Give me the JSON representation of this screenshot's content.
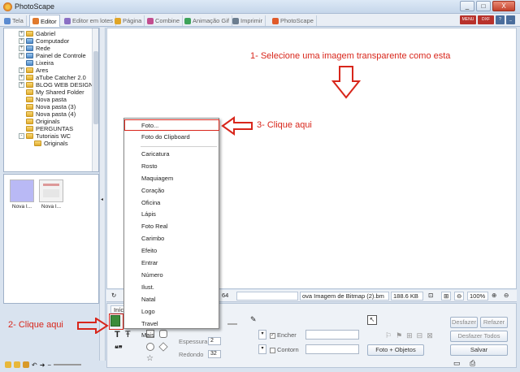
{
  "window": {
    "title": "PhotoScape",
    "controls": [
      "_",
      "□",
      "X"
    ]
  },
  "tabs": [
    {
      "label": "Tela",
      "color": "#5b8bd0",
      "active": false
    },
    {
      "label": "Editor",
      "color": "#e07a2e",
      "active": true
    },
    {
      "label": "Editor em lotes",
      "color": "#8a6fc4",
      "active": false
    },
    {
      "label": "Página",
      "color": "#e0a526",
      "active": false
    },
    {
      "label": "Combine",
      "color": "#c24d8f",
      "active": false
    },
    {
      "label": "Animação Gif",
      "color": "#3da35a",
      "active": false
    },
    {
      "label": "Imprimir",
      "color": "#6b7d8f",
      "active": false
    },
    {
      "label": "PhotoScape",
      "color": "#e05a2a",
      "active": false
    }
  ],
  "top_icons": [
    "MENU",
    "DXF",
    "?",
    "_"
  ],
  "tree": [
    {
      "label": "Gabriel",
      "expander": "+",
      "indent": 1,
      "icon": "folder"
    },
    {
      "label": "Computador",
      "expander": "+",
      "indent": 1,
      "icon": "folder-blue"
    },
    {
      "label": "Rede",
      "expander": "+",
      "indent": 1,
      "icon": "folder-blue"
    },
    {
      "label": "Painel de Controle",
      "expander": "+",
      "indent": 1,
      "icon": "folder-blue"
    },
    {
      "label": "Lixeira",
      "expander": "",
      "indent": 1,
      "icon": "folder-blue"
    },
    {
      "label": "Ares",
      "expander": "+",
      "indent": 1,
      "icon": "folder"
    },
    {
      "label": "aTube Catcher 2.0",
      "expander": "+",
      "indent": 1,
      "icon": "folder"
    },
    {
      "label": "BLOG WEB DESIGN",
      "expander": "+",
      "indent": 1,
      "icon": "folder"
    },
    {
      "label": "My Shared Folder",
      "expander": "",
      "indent": 1,
      "icon": "folder"
    },
    {
      "label": "Nova pasta",
      "expander": "",
      "indent": 1,
      "icon": "folder"
    },
    {
      "label": "Nova pasta (3)",
      "expander": "",
      "indent": 1,
      "icon": "folder"
    },
    {
      "label": "Nova pasta (4)",
      "expander": "",
      "indent": 1,
      "icon": "folder"
    },
    {
      "label": "Originals",
      "expander": "",
      "indent": 1,
      "icon": "folder"
    },
    {
      "label": "PERGUNTAS",
      "expander": "",
      "indent": 1,
      "icon": "folder"
    },
    {
      "label": "Tutoriais WC",
      "expander": "-",
      "indent": 1,
      "icon": "folder"
    },
    {
      "label": "Originals",
      "expander": "",
      "indent": 2,
      "icon": "folder"
    }
  ],
  "thumbnails": [
    {
      "caption": "Nova I...",
      "fill": "#b9b9f5"
    },
    {
      "caption": "Nova I...",
      "fill": "#f2f2f2"
    }
  ],
  "annotations": {
    "step1": "1- Selecione uma imagem transparente como esta",
    "step2": "2- Clique aqui",
    "step3": "3- Clique aqui",
    "arrow_color": "#d8261b"
  },
  "statusbar": {
    "left_value": "64",
    "filename": "ova Imagem de Bitmap (2).bm",
    "filesize": "188.6 KB",
    "zoom": "100%"
  },
  "context_menu": [
    {
      "label": "Foto...",
      "highlighted": true
    },
    {
      "label": "Foto do Clipboard",
      "highlighted": false
    },
    {
      "separator": true
    },
    {
      "label": "Caricatura"
    },
    {
      "label": "Rosto"
    },
    {
      "label": "Maquiagem"
    },
    {
      "label": "Coração"
    },
    {
      "label": "Oficina"
    },
    {
      "label": "Lápis"
    },
    {
      "label": "Foto Real"
    },
    {
      "label": "Carimbo"
    },
    {
      "label": "Efeito"
    },
    {
      "label": "Entrar"
    },
    {
      "label": "Número"
    },
    {
      "label": "Ilust."
    },
    {
      "label": "Natal"
    },
    {
      "label": "Logo"
    },
    {
      "label": "Travel"
    },
    {
      "label": "Mais"
    }
  ],
  "toolpanel": {
    "tab_label": "Início",
    "espessura_label": "Espessura",
    "espessura_value": "2",
    "redondo_label": "Redondo",
    "redondo_value": "32",
    "encher_label": "Encher",
    "encher_checked": true,
    "contorno_label": "Contorn",
    "contorno_checked": false,
    "foto_objetos_label": "Foto + Objetos",
    "desfazer_label": "Desfazer",
    "refazer_label": "Refazer",
    "desfazer_todos_label": "Desfazer Todos",
    "salvar_label": "Salvar",
    "text_tool_glyph": "T",
    "quote_glyph": "❝❞"
  }
}
